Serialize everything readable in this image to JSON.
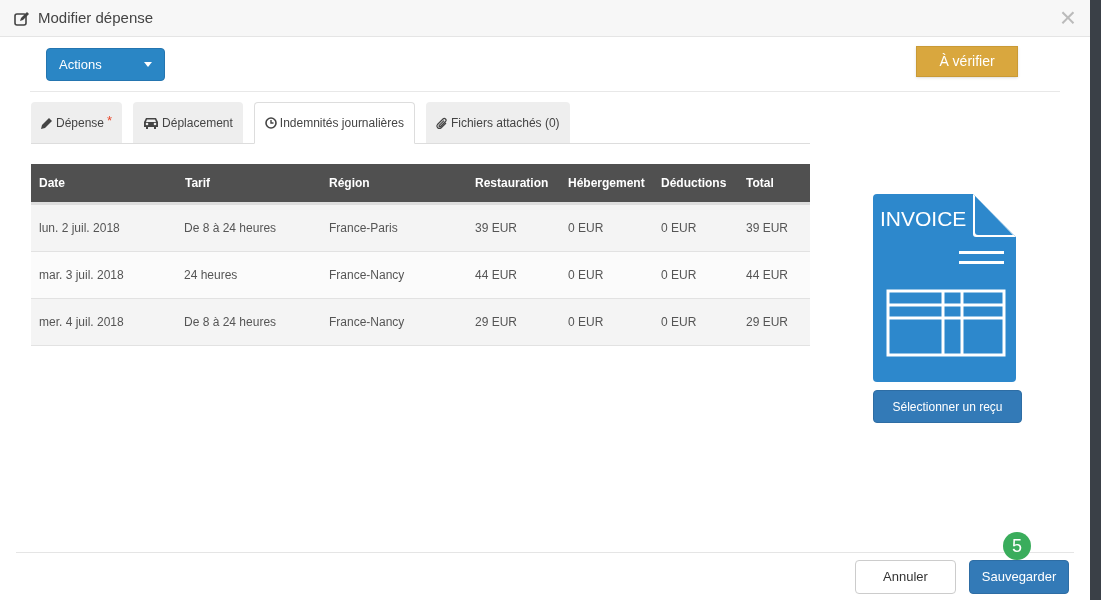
{
  "window": {
    "title": "Modifier dépense",
    "close": "×"
  },
  "actions_button": {
    "label": "Actions"
  },
  "status_button": {
    "label": "À vérifier"
  },
  "tabs": [
    {
      "label": "Dépense",
      "required": true,
      "required_mark": "*",
      "selected": false
    },
    {
      "label": "Déplacement",
      "required": false,
      "selected": false
    },
    {
      "label": "Indemnités journalières",
      "required": false,
      "selected": true
    },
    {
      "label": "Fichiers attachés (0)",
      "required": false,
      "selected": false
    }
  ],
  "table": {
    "columns": [
      "Date",
      "Tarif",
      "Région",
      "Restauration",
      "Hébergement",
      "Déductions",
      "Total"
    ],
    "rows": [
      [
        "lun. 2 juil. 2018",
        "De 8 à 24 heures",
        "France-Paris",
        "39 EUR",
        "0 EUR",
        "0 EUR",
        "39 EUR"
      ],
      [
        "mar. 3 juil. 2018",
        "24 heures",
        "France-Nancy",
        "44 EUR",
        "0 EUR",
        "0 EUR",
        "44 EUR"
      ],
      [
        "mer. 4 juil. 2018",
        "De 8 à 24 heures",
        "France-Nancy",
        "29 EUR",
        "0 EUR",
        "0 EUR",
        "29 EUR"
      ]
    ]
  },
  "receipt": {
    "image_text": "INVOICE",
    "button": "Sélectionner un reçu"
  },
  "footer": {
    "cancel": "Annuler",
    "save": "Sauvegarder",
    "step_badge": "5"
  }
}
